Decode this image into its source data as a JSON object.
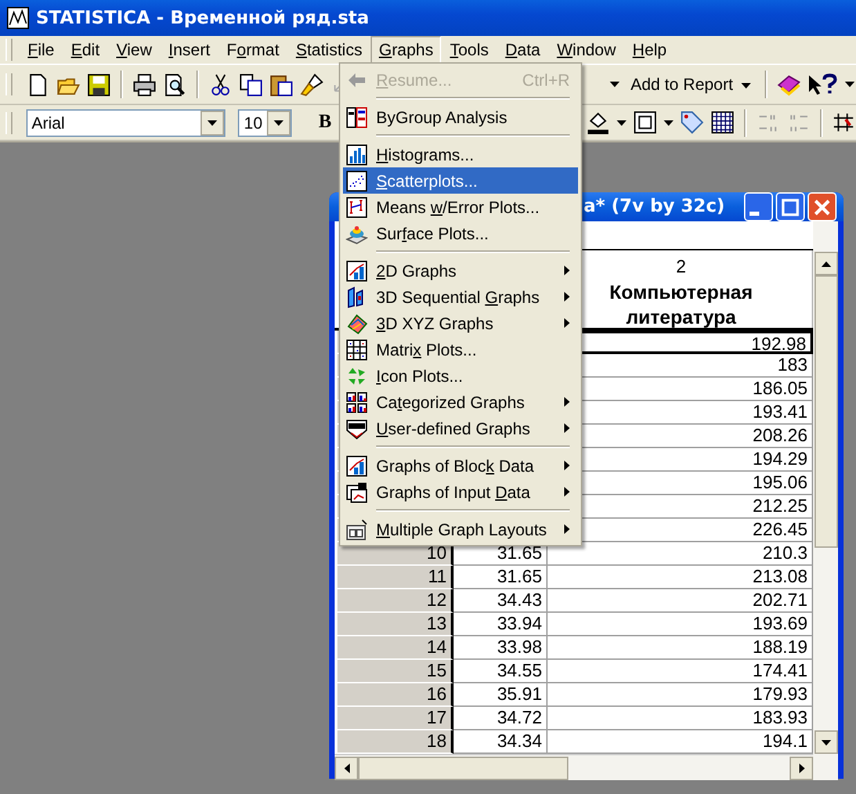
{
  "window": {
    "title": "STATISTICA - Временной ряд.sta"
  },
  "menu_bar": [
    {
      "label": {
        "key": "F",
        "post": "ile"
      },
      "selected": false
    },
    {
      "label": {
        "key": "E",
        "post": "dit"
      },
      "selected": false
    },
    {
      "label": {
        "key": "V",
        "post": "iew"
      },
      "selected": false
    },
    {
      "label": {
        "key": "I",
        "post": "nsert"
      },
      "selected": false
    },
    {
      "label": {
        "pre": "F",
        "key": "o",
        "post": "rmat"
      },
      "selected": false
    },
    {
      "label": {
        "key": "S",
        "post": "tatistics"
      },
      "selected": false
    },
    {
      "label": {
        "key": "G",
        "post": "raphs"
      },
      "selected": true
    },
    {
      "label": {
        "key": "T",
        "post": "ools"
      },
      "selected": false
    },
    {
      "label": {
        "key": "D",
        "post": "ata"
      },
      "selected": false
    },
    {
      "label": {
        "key": "W",
        "post": "indow"
      },
      "selected": false
    },
    {
      "label": {
        "key": "H",
        "post": "elp"
      },
      "selected": false
    }
  ],
  "toolbar": {
    "add_to_report": "Add to Report"
  },
  "format_bar": {
    "font": "Arial",
    "size": "10",
    "bold": "B"
  },
  "graphs_menu": [
    {
      "kind": "item",
      "label": {
        "key": "R",
        "post": "esume..."
      },
      "shortcut": "Ctrl+R",
      "disabled": true,
      "submenu": false,
      "selected": false
    },
    {
      "kind": "separator"
    },
    {
      "kind": "item",
      "label": {
        "post": "ByGroup Analysis"
      },
      "disabled": false,
      "submenu": false,
      "selected": false
    },
    {
      "kind": "separator"
    },
    {
      "kind": "item",
      "label": {
        "key": "H",
        "post": "istograms..."
      },
      "disabled": false,
      "submenu": false,
      "selected": false
    },
    {
      "kind": "item",
      "label": {
        "key": "S",
        "post": "catterplots..."
      },
      "disabled": false,
      "submenu": false,
      "selected": true
    },
    {
      "kind": "item",
      "label": {
        "pre": "Means ",
        "key": "w",
        "post": "/Error Plots..."
      },
      "disabled": false,
      "submenu": false,
      "selected": false
    },
    {
      "kind": "item",
      "label": {
        "pre": "Sur",
        "key": "f",
        "post": "ace Plots..."
      },
      "disabled": false,
      "submenu": false,
      "selected": false
    },
    {
      "kind": "separator"
    },
    {
      "kind": "item",
      "label": {
        "key": "2",
        "post": "D Graphs"
      },
      "disabled": false,
      "submenu": true,
      "selected": false
    },
    {
      "kind": "item",
      "label": {
        "pre": "3D Sequential ",
        "key": "G",
        "post": "raphs"
      },
      "disabled": false,
      "submenu": true,
      "selected": false
    },
    {
      "kind": "item",
      "label": {
        "key": "3",
        "post": "D XYZ Graphs"
      },
      "disabled": false,
      "submenu": true,
      "selected": false
    },
    {
      "kind": "item",
      "label": {
        "pre": "Matri",
        "key": "x",
        "post": " Plots..."
      },
      "disabled": false,
      "submenu": false,
      "selected": false
    },
    {
      "kind": "item",
      "label": {
        "key": "I",
        "post": "con Plots..."
      },
      "disabled": false,
      "submenu": false,
      "selected": false
    },
    {
      "kind": "item",
      "label": {
        "pre": "Ca",
        "key": "t",
        "post": "egorized Graphs"
      },
      "disabled": false,
      "submenu": true,
      "selected": false
    },
    {
      "kind": "item",
      "label": {
        "key": "U",
        "post": "ser-defined Graphs"
      },
      "disabled": false,
      "submenu": true,
      "selected": false
    },
    {
      "kind": "separator"
    },
    {
      "kind": "item",
      "label": {
        "pre": "Graphs of Bloc",
        "key": "k",
        "post": " Data"
      },
      "disabled": false,
      "submenu": true,
      "selected": false
    },
    {
      "kind": "item",
      "label": {
        "pre": "Graphs of Input ",
        "key": "D",
        "post": "ata"
      },
      "disabled": false,
      "submenu": true,
      "selected": false
    },
    {
      "kind": "separator"
    },
    {
      "kind": "item",
      "label": {
        "key": "M",
        "post": "ultiple Graph Layouts"
      },
      "disabled": false,
      "submenu": true,
      "selected": false
    }
  ],
  "data_window": {
    "title": "a* (7v by 32c)",
    "column": {
      "number": "2",
      "name": "Компьютерная литература"
    },
    "rows": [
      {
        "v2": "192.98",
        "selected": true
      },
      {
        "v2": "183",
        "selected": false
      },
      {
        "v2": "186.05",
        "selected": false
      },
      {
        "v2": "193.41",
        "selected": false
      },
      {
        "v2": "208.26",
        "selected": false
      },
      {
        "v2": "194.29",
        "selected": false
      },
      {
        "v2": "195.06",
        "selected": false
      },
      {
        "v2": "212.25",
        "selected": false
      },
      {
        "v2": "226.45",
        "selected": false
      },
      {
        "case": "10",
        "v1": "31.65",
        "v2": "210.3",
        "selected": false
      },
      {
        "case": "11",
        "v1": "31.65",
        "v2": "213.08",
        "selected": false
      },
      {
        "case": "12",
        "v1": "34.43",
        "v2": "202.71",
        "selected": false
      },
      {
        "case": "13",
        "v1": "33.94",
        "v2": "193.69",
        "selected": false
      },
      {
        "case": "14",
        "v1": "33.98",
        "v2": "188.19",
        "selected": false
      },
      {
        "case": "15",
        "v1": "34.55",
        "v2": "174.41",
        "selected": false
      },
      {
        "case": "16",
        "v1": "35.91",
        "v2": "179.93",
        "selected": false
      },
      {
        "case": "17",
        "v1": "34.72",
        "v2": "183.93",
        "selected": false
      },
      {
        "case": "18",
        "v1": "34.34",
        "v2": "194.1",
        "selected": false
      }
    ]
  }
}
